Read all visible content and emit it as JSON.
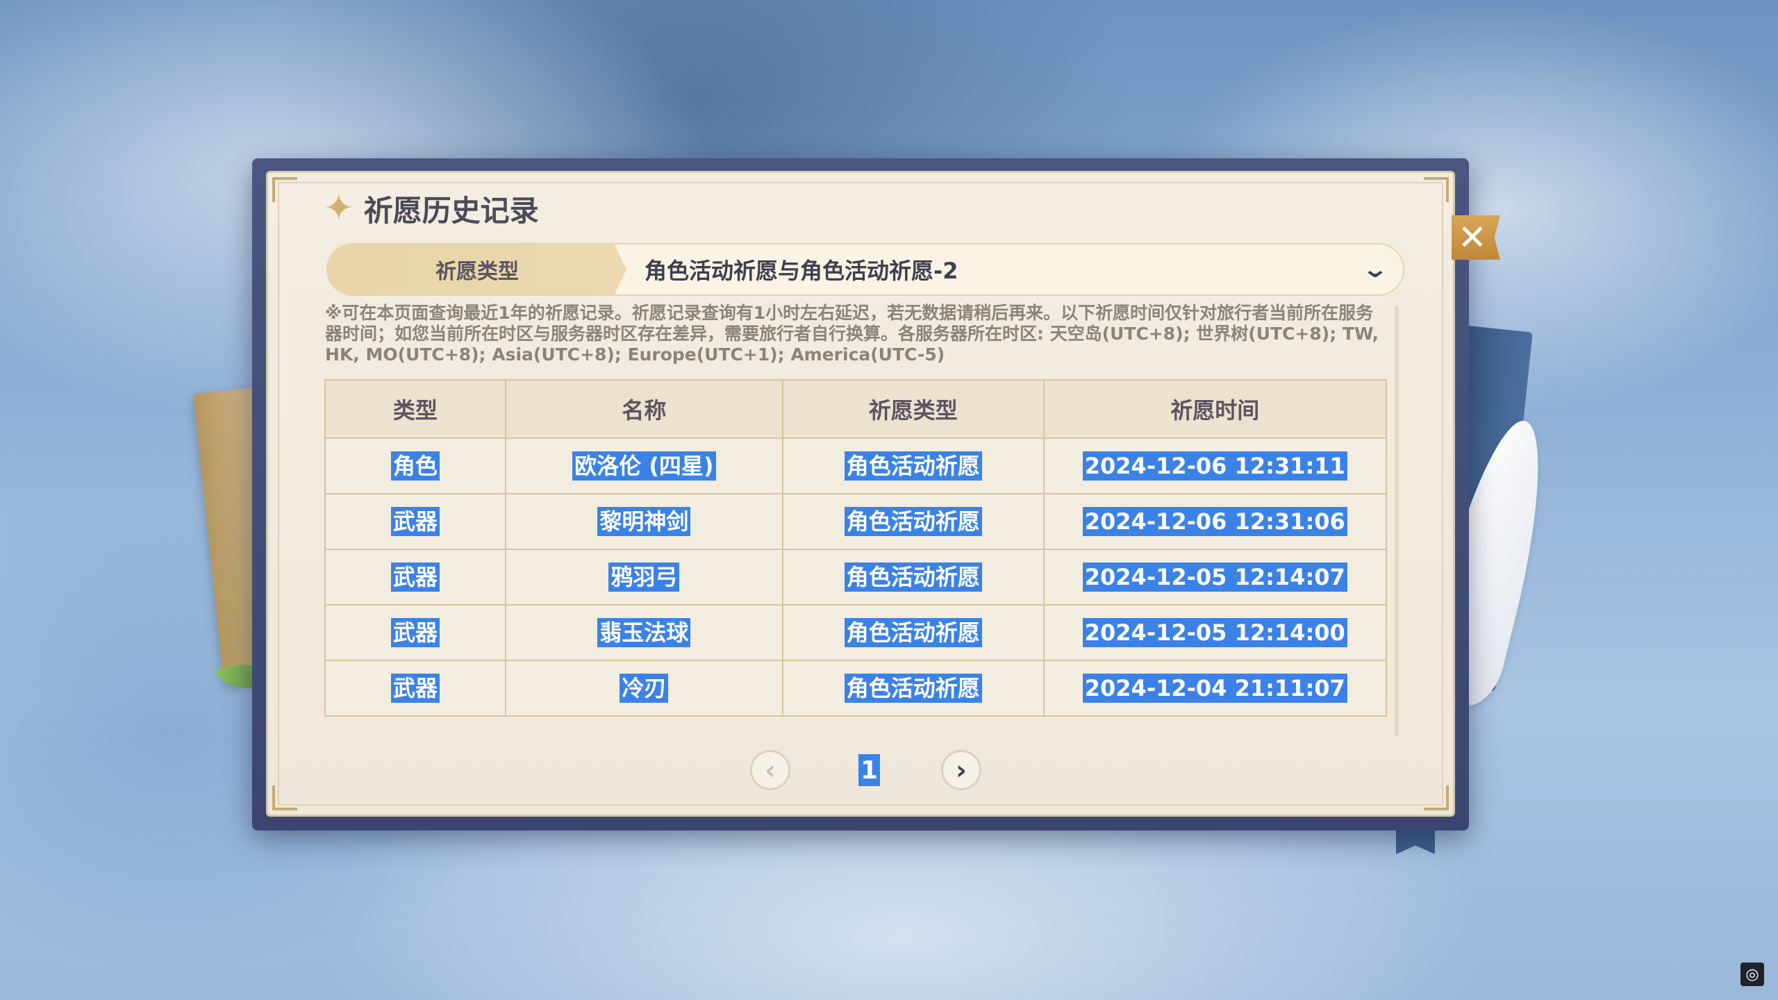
{
  "window": {
    "title": "祈愿历史记录"
  },
  "selector": {
    "label": "祈愿类型",
    "value": "角色活动祈愿与角色活动祈愿-2"
  },
  "notice": "※可在本页面查询最近1年的祈愿记录。祈愿记录查询有1小时左右延迟，若无数据请稍后再来。以下祈愿时间仅针对旅行者当前所在服务器时间；如您当前所在时区与服务器时区存在差异，需要旅行者自行换算。各服务器所在时区: 天空岛(UTC+8); 世界树(UTC+8); TW, HK, MO(UTC+8); Asia(UTC+8); Europe(UTC+1); America(UTC-5)",
  "table": {
    "headers": [
      "类型",
      "名称",
      "祈愿类型",
      "祈愿时间"
    ],
    "rows": [
      [
        "角色",
        "欧洛伦 (四星)",
        "角色活动祈愿",
        "2024-12-06 12:31:11"
      ],
      [
        "武器",
        "黎明神剑",
        "角色活动祈愿",
        "2024-12-06 12:31:06"
      ],
      [
        "武器",
        "鸦羽弓",
        "角色活动祈愿",
        "2024-12-05 12:14:07"
      ],
      [
        "武器",
        "翡玉法球",
        "角色活动祈愿",
        "2024-12-05 12:14:00"
      ],
      [
        "武器",
        "冷刃",
        "角色活动祈愿",
        "2024-12-04 21:11:07"
      ]
    ]
  },
  "pagination": {
    "current_page": "1",
    "prev_icon": "chevron-left-icon",
    "next_icon": "chevron-right-icon"
  },
  "icons": {
    "title": "sparkle-icon",
    "close": "close-icon",
    "dropdown": "chevron-down-icon",
    "corner": "target-icon"
  },
  "colors": {
    "selection_highlight": "#3b82e6",
    "panel_background": "#f3ede2",
    "close_button": "#d9a557"
  }
}
